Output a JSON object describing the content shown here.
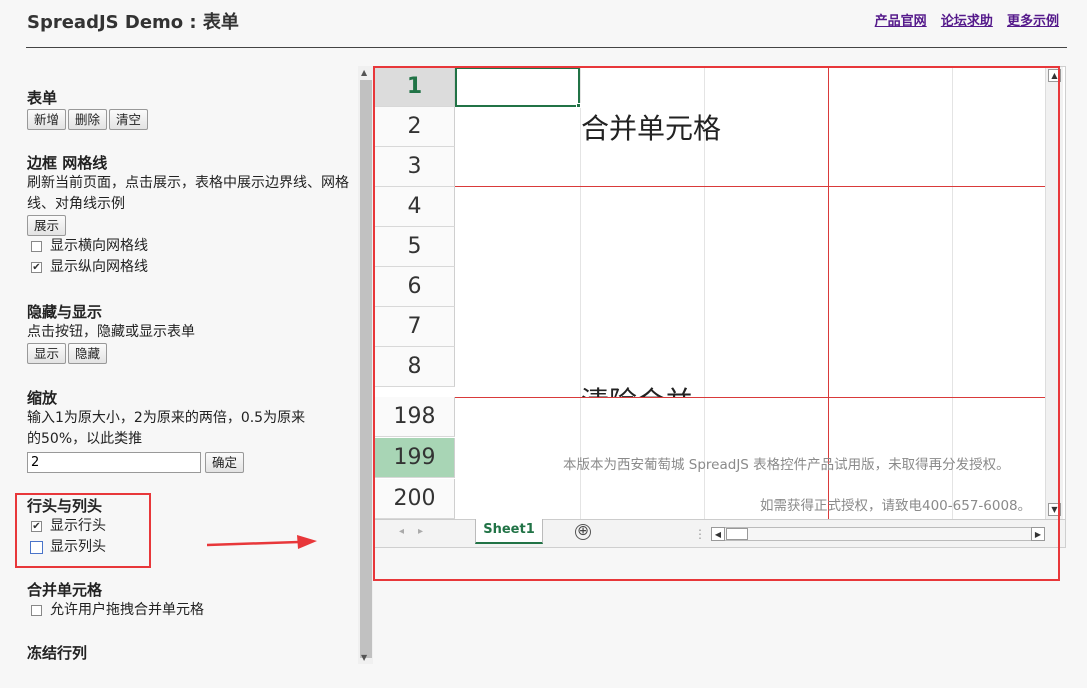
{
  "header": {
    "title": "SpreadJS Demo : 表单",
    "links": [
      "产品官网",
      "论坛求助",
      "更多示例"
    ]
  },
  "sidebar": {
    "form": {
      "title": "表单",
      "buttons": [
        "新增",
        "删除",
        "清空"
      ]
    },
    "border": {
      "title": "边框 网格线",
      "desc": "刷新当前页面，点击展示，表格中展示边界线、网格线、对角线示例",
      "button": "展示",
      "checks": [
        {
          "label": "显示横向网格线",
          "checked": false
        },
        {
          "label": "显示纵向网格线",
          "checked": true
        }
      ]
    },
    "hide": {
      "title": "隐藏与显示",
      "desc": "点击按钮，隐藏或显示表单",
      "buttons": [
        "显示",
        "隐藏"
      ]
    },
    "zoom": {
      "title": "缩放",
      "desc": "输入1为原大小，2为原来的两倍，0.5为原来的50%，以此类推",
      "value": "2",
      "button": "确定"
    },
    "headers": {
      "title": "行头与列头",
      "checks": [
        {
          "label": "显示行头",
          "checked": true
        },
        {
          "label": "显示列头",
          "checked": false
        }
      ]
    },
    "merge": {
      "title": "合并单元格",
      "checks": [
        {
          "label": "允许用户拖拽合并单元格",
          "checked": false
        }
      ]
    },
    "freeze": {
      "title": "冻结行列"
    }
  },
  "spreadsheet": {
    "rows": [
      "1",
      "2",
      "3",
      "4",
      "5",
      "6",
      "7",
      "8",
      "198",
      "199",
      "200"
    ],
    "merged_text": "合并单元格",
    "clipped_text": "清除合并",
    "watermark_line1": "本版本为西安葡萄城 SpreadJS 表格控件产品试用版，未取得再分发授权。",
    "watermark_line2": "如需获得正式授权，请致电400-657-6008。",
    "sheet_tab": "Sheet1"
  },
  "icons": {
    "check": "✔",
    "add_sheet": "⊕",
    "splitter": "⋮",
    "up": "▲",
    "down": "▼",
    "left": "◀",
    "right": "▶",
    "tab_nav": "◂▸"
  }
}
